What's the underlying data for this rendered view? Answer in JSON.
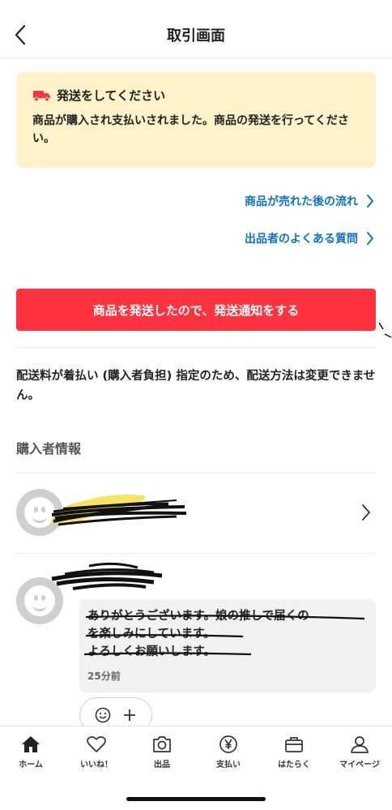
{
  "header": {
    "title": "取引画面"
  },
  "notice": {
    "title": "発送をしてください",
    "body": "商品が購入され支払いされました。商品の発送を行ってください。",
    "icon": "truck-icon",
    "icon_color": "#ff333f"
  },
  "links": [
    {
      "label": "商品が売れた後の流れ"
    },
    {
      "label": "出品者のよくある質問"
    }
  ],
  "cta": {
    "label": "商品を発送したので、発送通知をする",
    "color": "#ff333f"
  },
  "shipping_note": "配送料が着払い (購入者負担) 指定のため、配送方法は変更できません。",
  "buyer_section": {
    "title": "購入者情報"
  },
  "message": {
    "line1": "ありがとうございます。娘の推しで届くの",
    "line2": "を楽しみにしています。",
    "line3": "よろしくお願いします。",
    "time": "25分前"
  },
  "tabs": [
    {
      "label": "ホーム",
      "icon": "home-icon"
    },
    {
      "label": "いいね！",
      "icon": "heart-icon"
    },
    {
      "label": "出品",
      "icon": "camera-icon"
    },
    {
      "label": "支払い",
      "icon": "yen-icon"
    },
    {
      "label": "はたらく",
      "icon": "briefcase-icon"
    },
    {
      "label": "マイページ",
      "icon": "person-icon"
    }
  ],
  "colors": {
    "link": "#0b74c4",
    "notice_bg": "#fdf2c9",
    "accent": "#ff333f"
  }
}
